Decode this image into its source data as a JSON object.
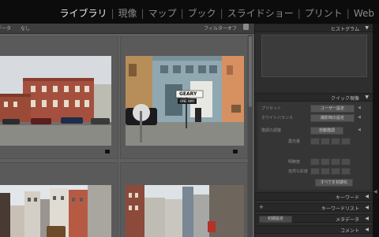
{
  "modules": [
    "ライブラリ",
    "現像",
    "マップ",
    "ブック",
    "スライドショー",
    "プリント",
    "Web"
  ],
  "active_module": "ライブラリ",
  "filter_bar": {
    "left_cut": "データ",
    "none": "なし",
    "filter_off": "フィルターオフ"
  },
  "street_sign": {
    "line1": "GEARY",
    "line2": "ONE WAY"
  },
  "panel": {
    "histogram": "ヒストグラム",
    "quick_develop": "クイック現像",
    "preset_label": "プリセット",
    "preset_value": "ユーザー設定",
    "wb_label": "ホワイトバランス",
    "wb_value": "撮影時の設定",
    "tone_label": "階調の調整",
    "tone_value": "自動階調",
    "exposure": "露光量",
    "clarity": "明瞭度",
    "vibrance": "自然な彩度",
    "reset": "すべてを初期化",
    "keywording": "キーワード",
    "keyword_list": "キーワードリスト",
    "default_value": "初期設定",
    "metadata": "メタデータ",
    "comments": "コメント"
  },
  "glyphs": {
    "collapse": "▼",
    "expand": "◀",
    "plus": "+"
  }
}
